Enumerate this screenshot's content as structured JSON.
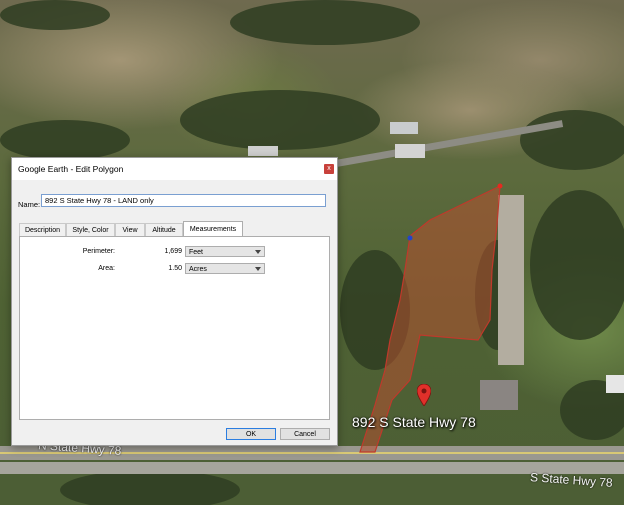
{
  "map": {
    "placemark_label": "892 S State Hwy 78",
    "roads": [
      {
        "label": "N State Hwy 78"
      },
      {
        "label": "S State Hwy 78"
      }
    ],
    "colors": {
      "parcel_fill": "#b5502f",
      "parcel_outline": "#c0392b",
      "pin": "#e0302a"
    }
  },
  "dialog": {
    "title": "Google Earth - Edit Polygon",
    "close_label": "x",
    "name_label": "Name:",
    "name_value": "892 S State Hwy 78 - LAND only",
    "tabs": [
      {
        "label": "Description"
      },
      {
        "label": "Style, Color"
      },
      {
        "label": "View"
      },
      {
        "label": "Altitude"
      },
      {
        "label": "Measurements",
        "active": true
      }
    ],
    "measurements": {
      "perimeter": {
        "label": "Perimeter:",
        "value": "1,699",
        "unit": "Feet"
      },
      "area": {
        "label": "Area:",
        "value": "1.50",
        "unit": "Acres"
      }
    },
    "buttons": {
      "ok": "OK",
      "cancel": "Cancel"
    }
  }
}
